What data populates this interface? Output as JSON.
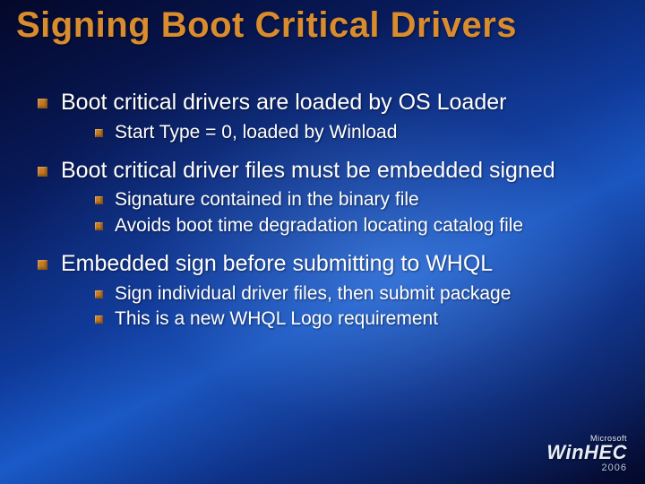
{
  "title": "Signing Boot Critical Drivers",
  "bullets": [
    {
      "text": "Boot critical drivers are loaded by OS Loader",
      "sub": [
        "Start Type = 0, loaded by Winload"
      ]
    },
    {
      "text": "Boot critical driver files must be embedded signed",
      "sub": [
        "Signature contained in the binary file",
        "Avoids boot time degradation locating catalog file"
      ]
    },
    {
      "text": "Embedded sign before submitting to WHQL",
      "sub": [
        "Sign individual driver files, then submit package",
        "This is a new WHQL Logo requirement"
      ]
    }
  ],
  "logo": {
    "company": "Microsoft",
    "event": "WinHEC",
    "year": "2006"
  }
}
